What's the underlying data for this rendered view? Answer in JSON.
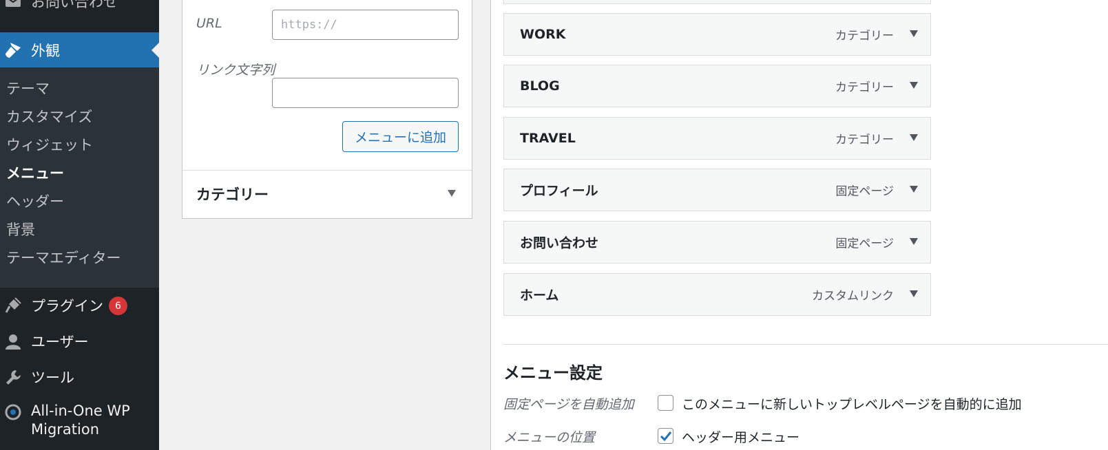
{
  "sidebar": {
    "contact_label": "お問い合わせ",
    "appearance_label": "外観",
    "submenu": [
      {
        "label": "テーマ"
      },
      {
        "label": "カスタマイズ"
      },
      {
        "label": "ウィジェット"
      },
      {
        "label": "メニュー"
      },
      {
        "label": "ヘッダー"
      },
      {
        "label": "背景"
      },
      {
        "label": "テーマエディター"
      }
    ],
    "plugins_label": "プラグイン",
    "plugins_badge": "6",
    "users_label": "ユーザー",
    "tools_label": "ツール",
    "aio_line1": "All-in-One WP",
    "aio_line2": "Migration"
  },
  "add_items": {
    "url_label": "URL",
    "url_placeholder": "https://",
    "link_text_label": "リンク文字列",
    "link_text_value": "",
    "add_button": "メニューに追加",
    "categories_title": "カテゴリー"
  },
  "menu_structure": {
    "items": [
      {
        "title": "WORK",
        "type": "カテゴリー"
      },
      {
        "title": "BLOG",
        "type": "カテゴリー"
      },
      {
        "title": "TRAVEL",
        "type": "カテゴリー"
      },
      {
        "title": "プロフィール",
        "type": "固定ページ"
      },
      {
        "title": "お問い合わせ",
        "type": "固定ページ"
      },
      {
        "title": "ホーム",
        "type": "カスタムリンク"
      }
    ]
  },
  "menu_settings": {
    "title": "メニュー設定",
    "auto_add_label": "固定ページを自動追加",
    "auto_add_text": "このメニューに新しいトップレベルページを自動的に追加",
    "auto_add_checked": false,
    "location_label": "メニューの位置",
    "location_text": "ヘッダー用メニュー",
    "location_checked": true
  },
  "colors": {
    "sidebar_bg": "#1d2327",
    "submenu_bg": "#2c3338",
    "accent": "#2271b1",
    "badge": "#d63638"
  }
}
